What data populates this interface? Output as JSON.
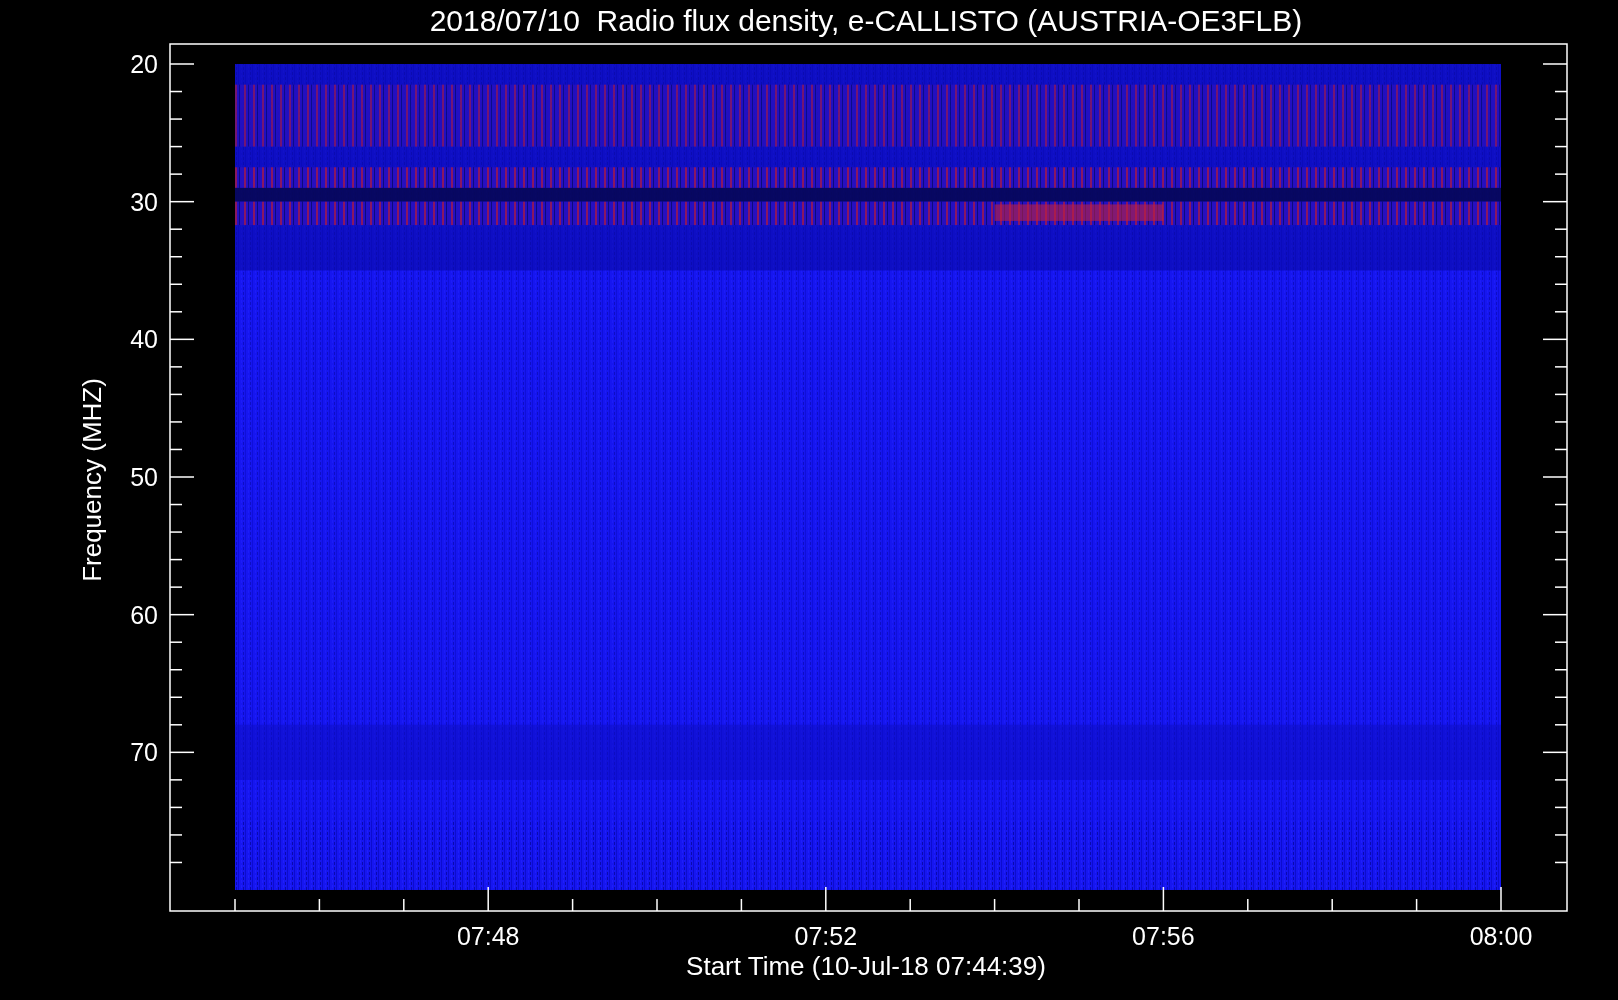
{
  "title": "2018/07/10  Radio flux density, e-CALLISTO (AUSTRIA-OE3FLB)",
  "y_axis": {
    "label": "Frequency (MHZ)",
    "ticks": [
      "20",
      "30",
      "40",
      "50",
      "60",
      "70"
    ]
  },
  "x_axis": {
    "label": "Start Time (10-Jul-18 07:44:39)",
    "ticks": [
      "07:48",
      "07:52",
      "07:56",
      "08:00"
    ]
  }
}
